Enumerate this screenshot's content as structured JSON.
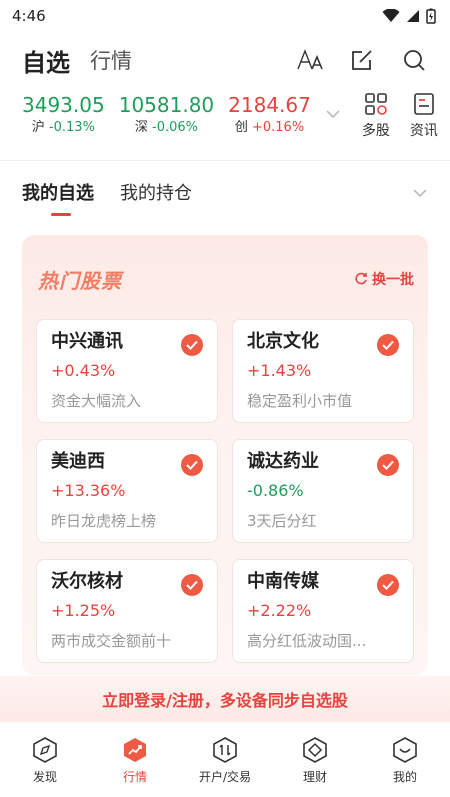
{
  "status_bar": {
    "time": "4:46"
  },
  "header": {
    "tab_main": "自选",
    "tab_sub": "行情",
    "icons": [
      "font-size-icon",
      "edit-icon",
      "search-icon"
    ]
  },
  "indices": [
    {
      "value": "3493.05",
      "name": "沪",
      "change": "-0.13%",
      "color": "#1e9e5a"
    },
    {
      "value": "10581.80",
      "name": "深",
      "change": "-0.06%",
      "color": "#1e9e5a"
    },
    {
      "value": "2184.67",
      "name": "创",
      "change": "+0.16%",
      "color": "#e8433e"
    }
  ],
  "quick_links": [
    {
      "label": "多股",
      "icon": "multi-stock-icon"
    },
    {
      "label": "资讯",
      "icon": "news-icon"
    }
  ],
  "sub_tabs": {
    "active": "我的自选",
    "other": "我的持仓"
  },
  "hot": {
    "title": "热门股票",
    "refresh_label": "换一批",
    "stocks": [
      {
        "name": "中兴通讯",
        "change": "+0.43%",
        "tag": "资金大幅流入"
      },
      {
        "name": "北京文化",
        "change": "+1.43%",
        "tag": "稳定盈利小市值"
      },
      {
        "name": "美迪西",
        "change": "+13.36%",
        "tag": "昨日龙虎榜上榜"
      },
      {
        "name": "诚达药业",
        "change": "-0.86%",
        "tag": "3天后分红"
      },
      {
        "name": "沃尔核材",
        "change": "+1.25%",
        "tag": "两市成交金额前十"
      },
      {
        "name": "中南传媒",
        "change": "+2.22%",
        "tag": "高分红低波动国..."
      }
    ]
  },
  "login_banner": "立即登录/注册，多设备同步自选股",
  "bottom_nav": [
    {
      "label": "发现",
      "icon": "compass-icon"
    },
    {
      "label": "行情",
      "icon": "market-icon"
    },
    {
      "label": "开户/交易",
      "icon": "trade-icon"
    },
    {
      "label": "理财",
      "icon": "wealth-icon"
    },
    {
      "label": "我的",
      "icon": "profile-icon"
    }
  ],
  "colors": {
    "up": "#e8433e",
    "down": "#1e9e5a",
    "accent": "#e8433e"
  }
}
